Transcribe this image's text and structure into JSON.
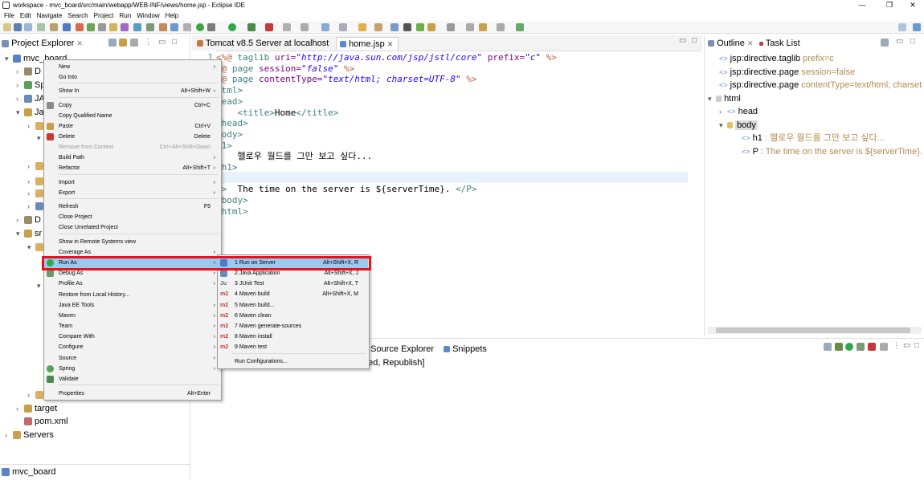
{
  "window": {
    "title": "workspace - mvc_board/src/main/webapp/WEB-INF/views/home.jsp - Eclipse IDE",
    "minimize": "—",
    "restore": "❐",
    "close": "✕"
  },
  "menubar": [
    "File",
    "Edit",
    "Navigate",
    "Search",
    "Project",
    "Run",
    "Window",
    "Help"
  ],
  "project_explorer": {
    "title": "Project Explorer",
    "tree": [
      {
        "label": "mvc_board"
      },
      {
        "label": "D"
      },
      {
        "label": "Sp"
      },
      {
        "label": "JA"
      },
      {
        "label": "Ja"
      },
      {
        "label": "D"
      },
      {
        "label": "sr"
      },
      {
        "label": "target"
      },
      {
        "label": "pom.xml"
      },
      {
        "label": "Servers"
      }
    ],
    "status": "mvc_board"
  },
  "editor": {
    "tabs": [
      {
        "label": "Tomcat v8.5 Server at localhost"
      },
      {
        "label": "home.jsp"
      }
    ],
    "line_number": "1",
    "lines": [
      {
        "parts": [
          {
            "t": "<%@ ",
            "c": "dir"
          },
          {
            "t": "taglib ",
            "c": "tag"
          },
          {
            "t": "uri=",
            "c": "attr"
          },
          {
            "t": "\"http://java.sun.com/jsp/jstl/core\"",
            "c": "str"
          },
          {
            "t": " prefix=",
            "c": "attr"
          },
          {
            "t": "\"c\"",
            "c": "str"
          },
          {
            "t": " %>",
            "c": "dir"
          }
        ]
      },
      {
        "parts": [
          {
            "t": "%@ ",
            "c": "dir"
          },
          {
            "t": "page ",
            "c": "tag"
          },
          {
            "t": "session=",
            "c": "attr"
          },
          {
            "t": "\"false\"",
            "c": "str"
          },
          {
            "t": " %>",
            "c": "dir"
          }
        ]
      },
      {
        "parts": [
          {
            "t": "%@ ",
            "c": "dir"
          },
          {
            "t": "page ",
            "c": "tag"
          },
          {
            "t": "contentType=",
            "c": "attr"
          },
          {
            "t": "\"text/html; charset=UTF-8\"",
            "c": "str"
          },
          {
            "t": " %>",
            "c": "dir"
          }
        ]
      },
      {
        "parts": [
          {
            "t": "html>",
            "c": "tag"
          }
        ]
      },
      {
        "parts": [
          {
            "t": "head>",
            "c": "tag"
          }
        ]
      },
      {
        "parts": [
          {
            "t": "    <title>",
            "c": "tag"
          },
          {
            "t": "Home",
            "c": ""
          },
          {
            "t": "</title>",
            "c": "tag"
          }
        ]
      },
      {
        "parts": [
          {
            "t": "/head>",
            "c": "tag"
          }
        ]
      },
      {
        "parts": [
          {
            "t": "body>",
            "c": "tag"
          }
        ]
      },
      {
        "parts": [
          {
            "t": "h1>",
            "c": "tag"
          }
        ]
      },
      {
        "parts": [
          {
            "t": "    헬로우 월드를 그만 보고 싶다...",
            "c": ""
          }
        ]
      },
      {
        "parts": [
          {
            "t": "/h1>",
            "c": "tag"
          }
        ]
      },
      {
        "parts": [
          {
            "t": "",
            "c": ""
          }
        ]
      },
      {
        "parts": [
          {
            "t": "P>",
            "c": "tag"
          },
          {
            "t": "  The time on the server is ${serverTime}. ",
            "c": ""
          },
          {
            "t": "</P>",
            "c": "tag"
          }
        ]
      },
      {
        "parts": [
          {
            "t": "/body>",
            "c": "tag"
          }
        ]
      },
      {
        "parts": [
          {
            "t": "/html>",
            "c": "tag"
          }
        ]
      }
    ]
  },
  "outline": {
    "tabs": [
      "Outline",
      "Task List"
    ],
    "items": [
      {
        "label": "jsp:directive.taglib",
        "extra": "prefix=c"
      },
      {
        "label": "jsp:directive.page",
        "extra": "session=false"
      },
      {
        "label": "jsp:directive.page",
        "extra": "contentType=text/html; charset"
      },
      {
        "label": "html",
        "extra": ""
      },
      {
        "label": "head",
        "extra": ""
      },
      {
        "label": "body",
        "extra": ""
      },
      {
        "label": "h1",
        "extra": ": 헬로우 월드를 그만 보고 싶다..."
      },
      {
        "label": "P",
        "extra": ": The time on the server is ${serverTime}."
      }
    ]
  },
  "bottom": {
    "tabs": [
      "a Source Explorer",
      "Snippets"
    ],
    "server_text": "ped, Republish]"
  },
  "context_menu": [
    {
      "label": "New",
      "shortcut": "",
      "arrow": true
    },
    {
      "label": "Go Into",
      "shortcut": ""
    },
    {
      "label": "Show In",
      "shortcut": "Alt+Shift+W",
      "arrow": true
    },
    {
      "label": "Copy",
      "shortcut": "Ctrl+C"
    },
    {
      "label": "Copy Qualified Name",
      "shortcut": ""
    },
    {
      "label": "Paste",
      "shortcut": "Ctrl+V"
    },
    {
      "label": "Delete",
      "shortcut": "Delete"
    },
    {
      "label": "Remove from Context",
      "shortcut": "Ctrl+Alt+Shift+Down",
      "disabled": true
    },
    {
      "label": "Build Path",
      "shortcut": "",
      "arrow": true
    },
    {
      "label": "Refactor",
      "shortcut": "Alt+Shift+T",
      "arrow": true
    },
    {
      "label": "Import",
      "shortcut": "",
      "arrow": true
    },
    {
      "label": "Export",
      "shortcut": "",
      "arrow": true
    },
    {
      "label": "Refresh",
      "shortcut": "F5"
    },
    {
      "label": "Close Project",
      "shortcut": ""
    },
    {
      "label": "Close Unrelated Project",
      "shortcut": ""
    },
    {
      "label": "Show in Remote Systems view",
      "shortcut": ""
    },
    {
      "label": "Coverage As",
      "shortcut": "",
      "arrow": true
    },
    {
      "label": "Run As",
      "shortcut": "",
      "arrow": true,
      "selected": true
    },
    {
      "label": "Debug As",
      "shortcut": "",
      "arrow": true
    },
    {
      "label": "Profile As",
      "shortcut": "",
      "arrow": true
    },
    {
      "label": "Restore from Local History...",
      "shortcut": ""
    },
    {
      "label": "Java EE Tools",
      "shortcut": "",
      "arrow": true
    },
    {
      "label": "Maven",
      "shortcut": "",
      "arrow": true
    },
    {
      "label": "Team",
      "shortcut": "",
      "arrow": true
    },
    {
      "label": "Compare With",
      "shortcut": "",
      "arrow": true
    },
    {
      "label": "Configure",
      "shortcut": "",
      "arrow": true
    },
    {
      "label": "Source",
      "shortcut": "",
      "arrow": true
    },
    {
      "label": "Spring",
      "shortcut": "",
      "arrow": true
    },
    {
      "label": "Validate",
      "shortcut": ""
    },
    {
      "label": "Properties",
      "shortcut": "Alt+Enter"
    }
  ],
  "submenu": [
    {
      "label": "1 Run on Server",
      "shortcut": "Alt+Shift+X, R",
      "icon": "",
      "selected": true
    },
    {
      "label": "2 Java Application",
      "shortcut": "Alt+Shift+X, J",
      "icon": ""
    },
    {
      "label": "3 JUnit Test",
      "shortcut": "Alt+Shift+X, T",
      "icon": "Ju"
    },
    {
      "label": "4 Maven build",
      "shortcut": "Alt+Shift+X, M",
      "icon": "m2"
    },
    {
      "label": "5 Maven build...",
      "shortcut": "",
      "icon": "m2"
    },
    {
      "label": "6 Maven clean",
      "shortcut": "",
      "icon": "m2"
    },
    {
      "label": "7 Maven generate-sources",
      "shortcut": "",
      "icon": "m2"
    },
    {
      "label": "8 Maven install",
      "shortcut": "",
      "icon": "m2"
    },
    {
      "label": "9 Maven test",
      "shortcut": "",
      "icon": "m2"
    },
    {
      "label": "Run Configurations...",
      "shortcut": "",
      "icon": ""
    }
  ],
  "colors": {
    "highlight": "#99c9ef",
    "callout": "#e8121e",
    "accent": "#1f6fc6"
  }
}
